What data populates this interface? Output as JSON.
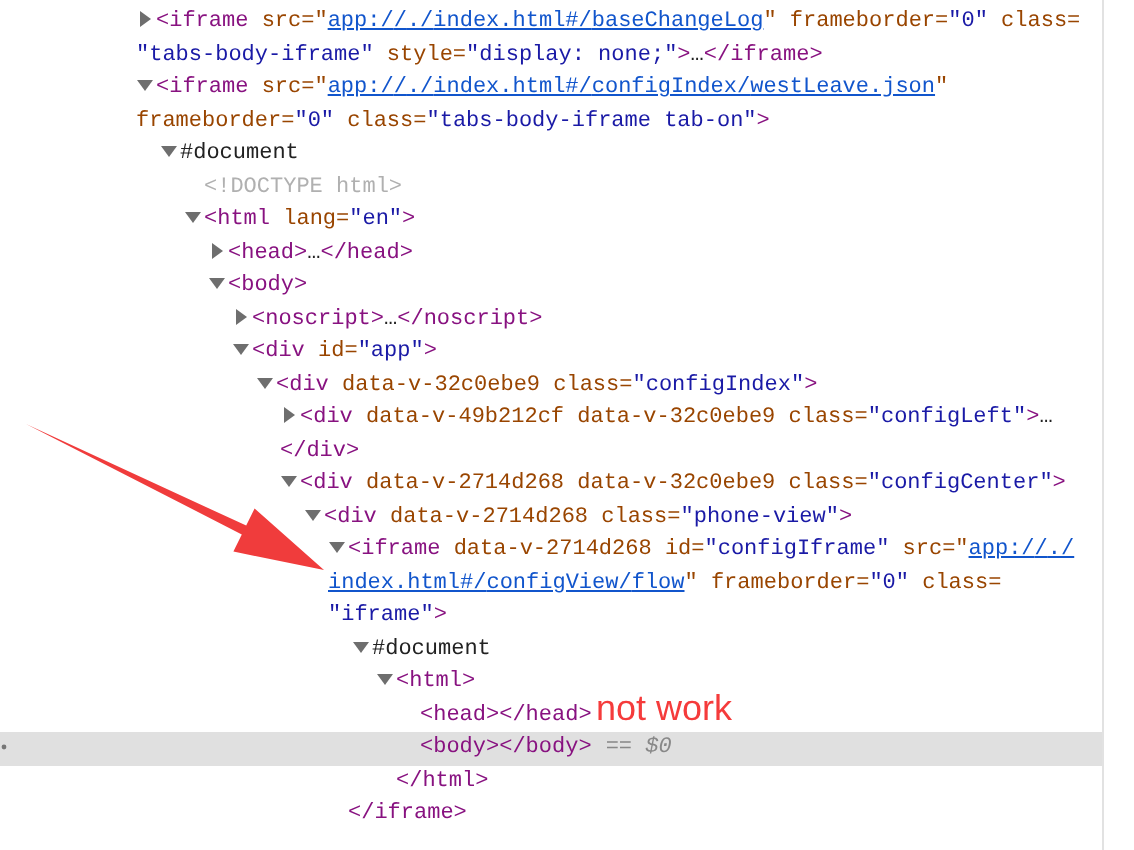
{
  "tree": [
    {
      "expanded": false,
      "selected": false,
      "parts": [
        {
          "kind": "tag",
          "text": "<iframe"
        },
        {
          "kind": "attr",
          "text": " src=\""
        },
        {
          "kind": "link",
          "text": "app://./index.html#/baseChangeLog"
        },
        {
          "kind": "attr",
          "text": "\" frameborder="
        },
        {
          "kind": "value",
          "text": "\"0\""
        },
        {
          "kind": "attr",
          "text": " class="
        },
        {
          "kind": "value",
          "text": "\"tabs-body-iframe\""
        },
        {
          "kind": "attr",
          "text": " style="
        },
        {
          "kind": "value",
          "text": "\"display: none;\""
        },
        {
          "kind": "tag",
          "text": ">"
        },
        {
          "kind": "text",
          "text": "…"
        },
        {
          "kind": "tag",
          "text": "</iframe>"
        }
      ]
    },
    {
      "expanded": true,
      "selected": false,
      "parts": [
        {
          "kind": "tag",
          "text": "<iframe"
        },
        {
          "kind": "attr",
          "text": " src=\""
        },
        {
          "kind": "link",
          "text": "app://./index.html#/configIndex/westLeave.json"
        },
        {
          "kind": "attr",
          "text": "\""
        },
        {
          "kind": "attr",
          "text": " frameborder="
        },
        {
          "kind": "value",
          "text": "\"0\""
        },
        {
          "kind": "attr",
          "text": " class="
        },
        {
          "kind": "value",
          "text": "\"tabs-body-iframe tab-on\""
        },
        {
          "kind": "tag",
          "text": ">"
        }
      ],
      "children": [
        {
          "expanded": true,
          "selected": false,
          "parts": [
            {
              "kind": "text",
              "text": "#document"
            }
          ],
          "children": [
            {
              "selected": false,
              "parts": [
                {
                  "kind": "doctype",
                  "text": "<!DOCTYPE html>"
                }
              ]
            },
            {
              "expanded": true,
              "selected": false,
              "parts": [
                {
                  "kind": "tag",
                  "text": "<html"
                },
                {
                  "kind": "attr",
                  "text": " lang="
                },
                {
                  "kind": "value",
                  "text": "\"en\""
                },
                {
                  "kind": "tag",
                  "text": ">"
                }
              ],
              "children": [
                {
                  "expanded": false,
                  "selected": false,
                  "parts": [
                    {
                      "kind": "tag",
                      "text": "<head>"
                    },
                    {
                      "kind": "text",
                      "text": "…"
                    },
                    {
                      "kind": "tag",
                      "text": "</head>"
                    }
                  ]
                },
                {
                  "expanded": true,
                  "selected": false,
                  "parts": [
                    {
                      "kind": "tag",
                      "text": "<body>"
                    }
                  ],
                  "children": [
                    {
                      "expanded": false,
                      "selected": false,
                      "parts": [
                        {
                          "kind": "tag",
                          "text": "<noscript>"
                        },
                        {
                          "kind": "text",
                          "text": "…"
                        },
                        {
                          "kind": "tag",
                          "text": "</noscript>"
                        }
                      ]
                    },
                    {
                      "expanded": true,
                      "selected": false,
                      "parts": [
                        {
                          "kind": "tag",
                          "text": "<div"
                        },
                        {
                          "kind": "attr",
                          "text": " id="
                        },
                        {
                          "kind": "value",
                          "text": "\"app\""
                        },
                        {
                          "kind": "tag",
                          "text": ">"
                        }
                      ],
                      "children": [
                        {
                          "expanded": true,
                          "selected": false,
                          "parts": [
                            {
                              "kind": "tag",
                              "text": "<div"
                            },
                            {
                              "kind": "attr",
                              "text": " data-v-32c0ebe9"
                            },
                            {
                              "kind": "attr",
                              "text": " class="
                            },
                            {
                              "kind": "value",
                              "text": "\"configIndex\""
                            },
                            {
                              "kind": "tag",
                              "text": ">"
                            }
                          ],
                          "children": [
                            {
                              "expanded": false,
                              "selected": false,
                              "parts": [
                                {
                                  "kind": "tag",
                                  "text": "<div"
                                },
                                {
                                  "kind": "attr",
                                  "text": " data-v-49b212cf"
                                },
                                {
                                  "kind": "attr",
                                  "text": " data-v-32c0ebe9"
                                },
                                {
                                  "kind": "attr",
                                  "text": " class="
                                },
                                {
                                  "kind": "value",
                                  "text": "\"configLeft\""
                                },
                                {
                                  "kind": "tag",
                                  "text": ">"
                                },
                                {
                                  "kind": "text",
                                  "text": "…"
                                },
                                {
                                  "kind": "tag",
                                  "text": "</div>"
                                }
                              ]
                            },
                            {
                              "expanded": true,
                              "selected": false,
                              "parts": [
                                {
                                  "kind": "tag",
                                  "text": "<div"
                                },
                                {
                                  "kind": "attr",
                                  "text": " data-v-2714d268"
                                },
                                {
                                  "kind": "attr",
                                  "text": " data-v-32c0ebe9"
                                },
                                {
                                  "kind": "attr",
                                  "text": " class="
                                },
                                {
                                  "kind": "value",
                                  "text": "\"configCenter\""
                                },
                                {
                                  "kind": "tag",
                                  "text": ">"
                                }
                              ],
                              "children": [
                                {
                                  "expanded": true,
                                  "selected": false,
                                  "parts": [
                                    {
                                      "kind": "tag",
                                      "text": "<div"
                                    },
                                    {
                                      "kind": "attr",
                                      "text": " data-v-2714d268"
                                    },
                                    {
                                      "kind": "attr",
                                      "text": " class="
                                    },
                                    {
                                      "kind": "value",
                                      "text": "\"phone-view\""
                                    },
                                    {
                                      "kind": "tag",
                                      "text": ">"
                                    }
                                  ],
                                  "children": [
                                    {
                                      "expanded": true,
                                      "selected": false,
                                      "parts": [
                                        {
                                          "kind": "tag",
                                          "text": "<iframe"
                                        },
                                        {
                                          "kind": "attr",
                                          "text": " data-v-2714d268"
                                        },
                                        {
                                          "kind": "attr",
                                          "text": " id="
                                        },
                                        {
                                          "kind": "value",
                                          "text": "\"configIframe\""
                                        },
                                        {
                                          "kind": "attr",
                                          "text": " src=\""
                                        },
                                        {
                                          "kind": "link",
                                          "text": "app://./index.html#/configView/flow"
                                        },
                                        {
                                          "kind": "attr",
                                          "text": "\""
                                        },
                                        {
                                          "kind": "attr",
                                          "text": " frameborder="
                                        },
                                        {
                                          "kind": "value",
                                          "text": "\"0\""
                                        },
                                        {
                                          "kind": "attr",
                                          "text": " class="
                                        },
                                        {
                                          "kind": "value",
                                          "text": "\"iframe\""
                                        },
                                        {
                                          "kind": "tag",
                                          "text": ">"
                                        }
                                      ],
                                      "closing": "</iframe>",
                                      "children": [
                                        {
                                          "expanded": true,
                                          "selected": false,
                                          "parts": [
                                            {
                                              "kind": "text",
                                              "text": "#document"
                                            }
                                          ],
                                          "children": [
                                            {
                                              "expanded": true,
                                              "selected": false,
                                              "parts": [
                                                {
                                                  "kind": "tag",
                                                  "text": "<html>"
                                                }
                                              ],
                                              "closing": "</html>",
                                              "children": [
                                                {
                                                  "selected": false,
                                                  "parts": [
                                                    {
                                                      "kind": "tag",
                                                      "text": "<head></head>"
                                                    }
                                                  ]
                                                },
                                                {
                                                  "selected": true,
                                                  "parts": [
                                                    {
                                                      "kind": "tag",
                                                      "text": "<body></body>"
                                                    }
                                                  ],
                                                  "console_ref": "== $0"
                                                }
                                              ]
                                            }
                                          ]
                                        }
                                      ]
                                    }
                                  ]
                                }
                              ]
                            }
                          ]
                        }
                      ]
                    }
                  ]
                }
              ]
            }
          ]
        }
      ]
    }
  ],
  "annotation": {
    "note": "not work"
  }
}
